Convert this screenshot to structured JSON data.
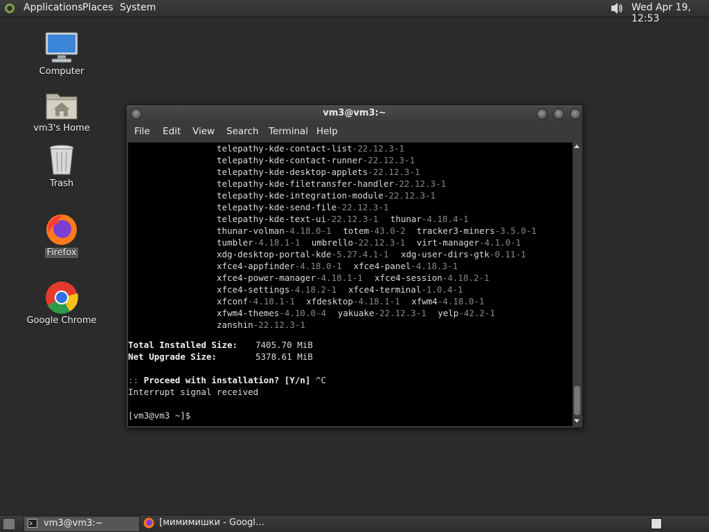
{
  "top_panel": {
    "menu": [
      "Applications",
      "Places",
      "System"
    ],
    "clock": "Wed Apr 19, 12:53"
  },
  "desktop_icons": [
    {
      "label": "Computer",
      "icon": "computer-icon"
    },
    {
      "label": "vm3's Home",
      "icon": "home-folder-icon"
    },
    {
      "label": "Trash",
      "icon": "trash-icon"
    },
    {
      "label": "Firefox",
      "icon": "firefox-icon"
    },
    {
      "label": "Google Chrome",
      "icon": "chrome-icon"
    }
  ],
  "terminal": {
    "title": "vm3@vm3:~",
    "menu": [
      "File",
      "Edit",
      "View",
      "Search",
      "Terminal",
      "Help"
    ],
    "package_lines": [
      [
        [
          "telepathy-kde-contact-list",
          "-22.12.3-1"
        ]
      ],
      [
        [
          "telepathy-kde-contact-runner",
          "-22.12.3-1"
        ]
      ],
      [
        [
          "telepathy-kde-desktop-applets",
          "-22.12.3-1"
        ]
      ],
      [
        [
          "telepathy-kde-filetransfer-handler",
          "-22.12.3-1"
        ]
      ],
      [
        [
          "telepathy-kde-integration-module",
          "-22.12.3-1"
        ]
      ],
      [
        [
          "telepathy-kde-send-file",
          "-22.12.3-1"
        ]
      ],
      [
        [
          "telepathy-kde-text-ui",
          "-22.12.3-1"
        ],
        [
          "thunar",
          "-4.18.4-1"
        ]
      ],
      [
        [
          "thunar-volman",
          "-4.18.0-1"
        ],
        [
          "totem",
          "-43.0-2"
        ],
        [
          "tracker3-miners",
          "-3.5.0-1"
        ]
      ],
      [
        [
          "tumbler",
          "-4.18.1-1"
        ],
        [
          "umbrello",
          "-22.12.3-1"
        ],
        [
          "virt-manager",
          "-4.1.0-1"
        ]
      ],
      [
        [
          "xdg-desktop-portal-kde",
          "-5.27.4.1-1"
        ],
        [
          "xdg-user-dirs-gtk",
          "-0.11-1"
        ]
      ],
      [
        [
          "xfce4-appfinder",
          "-4.18.0-1"
        ],
        [
          "xfce4-panel",
          "-4.18.3-1"
        ]
      ],
      [
        [
          "xfce4-power-manager",
          "-4.18.1-1"
        ],
        [
          "xfce4-session",
          "-4.18.2-1"
        ]
      ],
      [
        [
          "xfce4-settings",
          "-4.18.2-1"
        ],
        [
          "xfce4-terminal",
          "-1.0.4-1"
        ]
      ],
      [
        [
          "xfconf",
          "-4.18.1-1"
        ],
        [
          "xfdesktop",
          "-4.18.1-1"
        ],
        [
          "xfwm4",
          "-4.18.0-1"
        ]
      ],
      [
        [
          "xfwm4-themes",
          "-4.10.0-4"
        ],
        [
          "yakuake",
          "-22.12.3-1"
        ],
        [
          "yelp",
          "-42.2-1"
        ]
      ],
      [
        [
          "zanshin",
          "-22.12.3-1"
        ]
      ]
    ],
    "total_installed_label": "Total Installed Size:",
    "total_installed_value": "7405.70 MiB",
    "net_upgrade_label": "Net Upgrade Size:",
    "net_upgrade_value": "5378.61 MiB",
    "prompt_prefix": "::",
    "prompt_question": "Proceed with installation? [Y/n]",
    "prompt_input": "^C",
    "interrupt_message": "Interrupt signal received",
    "shell_prompt": "[vm3@vm3 ~]$"
  },
  "taskbar": {
    "tasks": [
      {
        "label": "vm3@vm3:~"
      },
      {
        "label": "[мимимишки - Googl…"
      }
    ]
  }
}
